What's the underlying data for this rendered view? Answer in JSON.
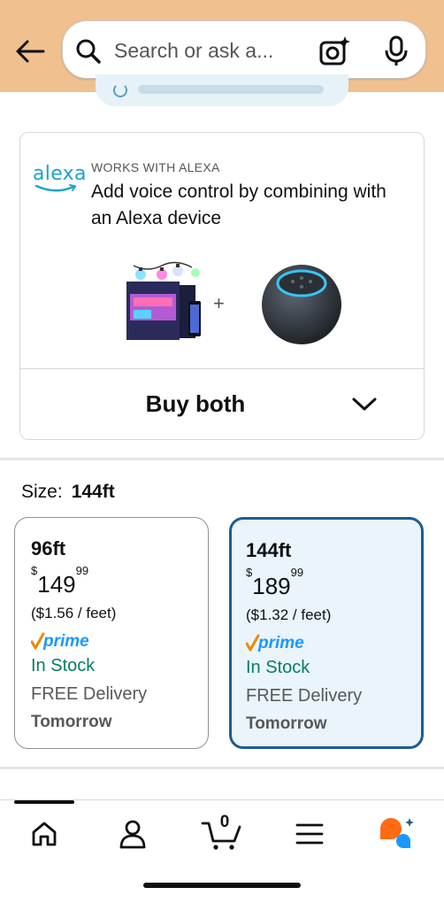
{
  "search": {
    "placeholder": "Search or ask a..."
  },
  "alexa": {
    "logo_text": "alexa",
    "works_with": "WORKS WITH ALEXA",
    "headline": "Add voice control by combining with an Alexa device",
    "plus": "+",
    "buy_both_label": "Buy both"
  },
  "size": {
    "label": "Size:",
    "selected": "144ft",
    "options": [
      {
        "length": "96ft",
        "currency": "$",
        "price_whole": "149",
        "price_fraction": "99",
        "unit_price": "($1.56 / feet)",
        "prime": "prime",
        "stock": "In Stock",
        "delivery": "FREE Delivery",
        "delivery_day": "Tomorrow",
        "selected": false
      },
      {
        "length": "144ft",
        "currency": "$",
        "price_whole": "189",
        "price_fraction": "99",
        "unit_price": "($1.32 / feet)",
        "prime": "prime",
        "stock": "In Stock",
        "delivery": "FREE Delivery",
        "delivery_day": "Tomorrow",
        "selected": true
      }
    ]
  },
  "bottom_nav": {
    "items": [
      "home-icon",
      "account-icon",
      "cart-icon",
      "menu-icon",
      "rufus-icon"
    ],
    "cart_count": "0"
  },
  "colors": {
    "header_bg": "#f0c08e",
    "alexa_blue": "#1ca3ce",
    "in_stock_green": "#067d62",
    "selected_border": "#1f5c8e",
    "selected_bg": "#eaf4fb",
    "prime_blue": "#1a98ff",
    "prime_orange": "#f08804"
  }
}
